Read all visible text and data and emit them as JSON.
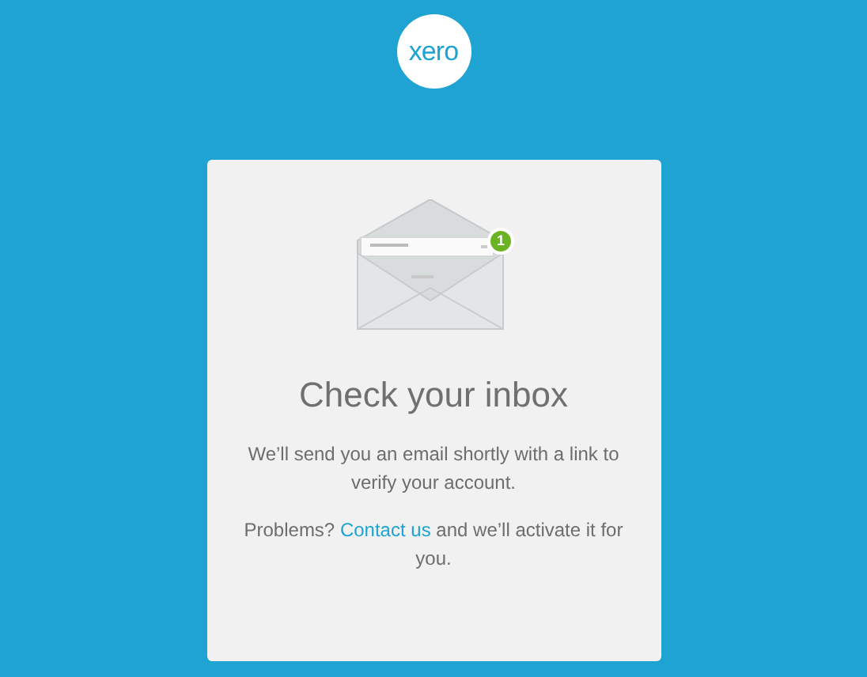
{
  "logo": {
    "text": "xero"
  },
  "card": {
    "badge": "1",
    "title": "Check your inbox",
    "message": "We’ll send you an email shortly with a link to verify your account.",
    "help": {
      "before": "Problems?",
      "link": "Contact us",
      "after": "and we’ll activate it for you."
    }
  }
}
